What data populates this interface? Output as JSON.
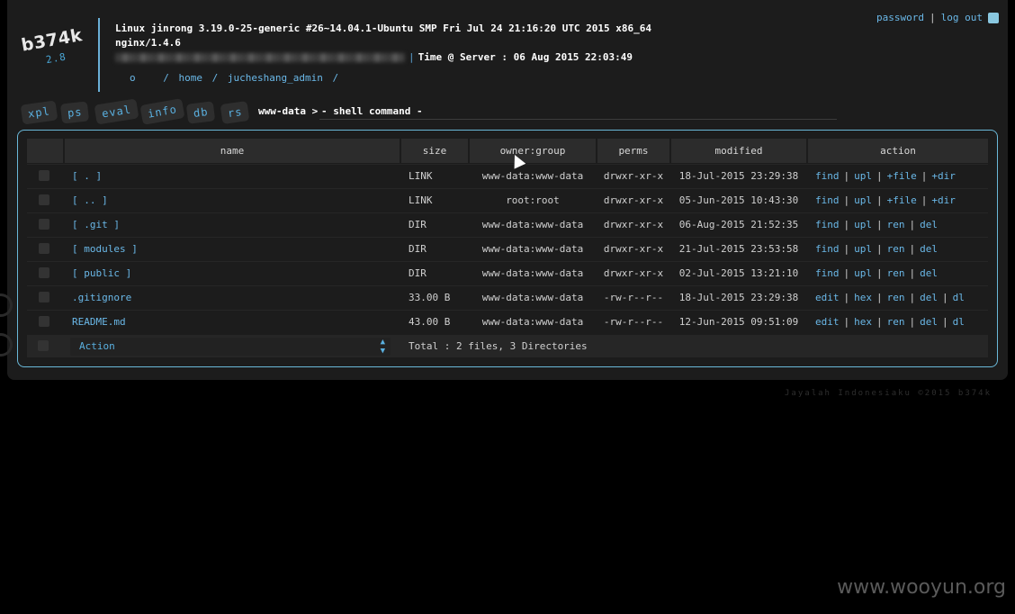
{
  "logo": {
    "name": "b374k",
    "version": "2.8"
  },
  "system": {
    "uname": "Linux jinrong 3.19.0-25-generic #26~14.04.1-Ubuntu SMP Fri Jul 24 21:16:20 UTC 2015 x86_64",
    "server_software": "nginx/1.4.6",
    "separator": "|",
    "server_time": "Time @ Server : 06 Aug 2015 22:03:49"
  },
  "path": {
    "root_link": "o",
    "separator": "/",
    "segments": [
      "home",
      "jucheshang_admin"
    ]
  },
  "top_right": {
    "password_link": "password",
    "separator": "|",
    "logout_link": "log out"
  },
  "menu": {
    "tabs": [
      "xpl",
      "ps",
      "eval",
      "info",
      "db",
      "rs"
    ]
  },
  "shell": {
    "prompt": "www-data >",
    "placeholder": "- shell command -"
  },
  "table": {
    "headers": {
      "name": "name",
      "size": "size",
      "owner": "owner:group",
      "perms": "perms",
      "modified": "modified",
      "action": "action"
    },
    "action_separator": "|",
    "rows": [
      {
        "name": "[ . ]",
        "size": "LINK",
        "owner": "www-data:www-data",
        "perms": "drwxr-xr-x",
        "modified": "18-Jul-2015 23:29:38",
        "actions": [
          "find",
          "upl",
          "+file",
          "+dir"
        ]
      },
      {
        "name": "[ .. ]",
        "size": "LINK",
        "owner": "root:root",
        "perms": "drwxr-xr-x",
        "modified": "05-Jun-2015 10:43:30",
        "actions": [
          "find",
          "upl",
          "+file",
          "+dir"
        ]
      },
      {
        "name": "[ .git ]",
        "size": "DIR",
        "owner": "www-data:www-data",
        "perms": "drwxr-xr-x",
        "modified": "06-Aug-2015 21:52:35",
        "actions": [
          "find",
          "upl",
          "ren",
          "del"
        ]
      },
      {
        "name": "[ modules ]",
        "size": "DIR",
        "owner": "www-data:www-data",
        "perms": "drwxr-xr-x",
        "modified": "21-Jul-2015 23:53:58",
        "actions": [
          "find",
          "upl",
          "ren",
          "del"
        ]
      },
      {
        "name": "[ public ]",
        "size": "DIR",
        "owner": "www-data:www-data",
        "perms": "drwxr-xr-x",
        "modified": "02-Jul-2015 13:21:10",
        "actions": [
          "find",
          "upl",
          "ren",
          "del"
        ]
      },
      {
        "name": ".gitignore",
        "size": "33.00 B",
        "owner": "www-data:www-data",
        "perms": "-rw-r--r--",
        "modified": "18-Jul-2015 23:29:38",
        "actions": [
          "edit",
          "hex",
          "ren",
          "del",
          "dl"
        ]
      },
      {
        "name": "README.md",
        "size": "43.00 B",
        "owner": "www-data:www-data",
        "perms": "-rw-r--r--",
        "modified": "12-Jun-2015 09:51:09",
        "actions": [
          "edit",
          "hex",
          "ren",
          "del",
          "dl"
        ]
      }
    ],
    "footer": {
      "select_value": "Action",
      "total": "Total : 2 files, 3 Directories"
    }
  },
  "credit": "Jayalah Indonesiaku ©2015 b374k",
  "watermark": "www.wooyun.org",
  "colors": {
    "link": "#6ab8e8",
    "accent_border": "#6ab8d8",
    "panel_bg": "#1c1c1c"
  }
}
